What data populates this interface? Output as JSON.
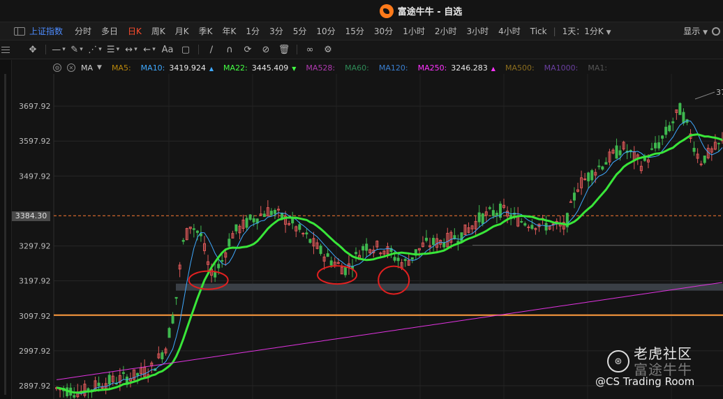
{
  "window": {
    "title": "富途牛牛 - 自选"
  },
  "toolbar": {
    "index_name": "上证指数",
    "periods": [
      {
        "label": "分时",
        "active": false
      },
      {
        "label": "多日",
        "active": false
      },
      {
        "label": "日K",
        "active": true
      },
      {
        "label": "周K",
        "active": false
      },
      {
        "label": "月K",
        "active": false
      },
      {
        "label": "季K",
        "active": false
      },
      {
        "label": "年K",
        "active": false
      },
      {
        "label": "1分",
        "active": false
      },
      {
        "label": "3分",
        "active": false
      },
      {
        "label": "5分",
        "active": false
      },
      {
        "label": "10分",
        "active": false
      },
      {
        "label": "15分",
        "active": false
      },
      {
        "label": "30分",
        "active": false
      },
      {
        "label": "1小时",
        "active": false
      },
      {
        "label": "2小时",
        "active": false
      },
      {
        "label": "3小时",
        "active": false
      },
      {
        "label": "4小时",
        "active": false
      },
      {
        "label": "Tick",
        "active": false
      }
    ],
    "range_select": "1天：1分K",
    "display_label": "显示",
    "accent_color": "#4d8cff",
    "active_color": "#ff4d2e"
  },
  "drawing_tools": {
    "text_tool_label": "Aa",
    "icons": [
      "crosshair-icon",
      "line-tool-icon",
      "pen-tool-icon",
      "multi-line-icon",
      "fib-tool-icon",
      "measure-icon",
      "arrow-tool-icon",
      "text-tool-icon",
      "note-icon",
      "brush-icon",
      "magnet-icon",
      "sync-icon",
      "hide-icon",
      "trash-icon",
      "link-icon",
      "settings-icon"
    ]
  },
  "legend": {
    "indicator": "MA",
    "items": [
      {
        "label": "MA5:",
        "value": "",
        "color": "#b8860b",
        "trend": ""
      },
      {
        "label": "MA10:",
        "value": "3419.924",
        "color": "#3fa9ff",
        "trend": "▲"
      },
      {
        "label": "MA22:",
        "value": "3445.409",
        "color": "#44ff44",
        "trend": "▼"
      },
      {
        "label": "MA528:",
        "value": "",
        "color": "#b03ab0",
        "trend": ""
      },
      {
        "label": "MA60:",
        "value": "",
        "color": "#2e8b57",
        "trend": ""
      },
      {
        "label": "MA120:",
        "value": "",
        "color": "#3a7fd0",
        "trend": ""
      },
      {
        "label": "MA250:",
        "value": "3246.283",
        "color": "#ff33ff",
        "trend": "▲"
      },
      {
        "label": "MA500:",
        "value": "",
        "color": "#8b6d1e",
        "trend": ""
      },
      {
        "label": "MA1000:",
        "value": "",
        "color": "#6a3fa0",
        "trend": ""
      },
      {
        "label": "MA1:",
        "value": "",
        "color": "#555555",
        "trend": ""
      }
    ]
  },
  "chart_data": {
    "type": "candlestick",
    "y_ticks": [
      "3697.92",
      "3597.92",
      "3497.92",
      "3297.92",
      "3197.92",
      "3097.92",
      "2997.92",
      "2897.92"
    ],
    "y_tick_values": [
      3697.92,
      3597.92,
      3497.92,
      3297.92,
      3197.92,
      3097.92,
      2997.92,
      2897.92
    ],
    "ylim": [
      2860,
      3790
    ],
    "last_price": "3384.30",
    "last_price_value": 3384.3,
    "peak_label_partial": "37",
    "horizontal_levels": [
      {
        "value": 3100,
        "color": "#ff9a3c",
        "kind": "support-line"
      },
      {
        "value": 3300,
        "color": "#555555",
        "kind": "resistance-line"
      }
    ],
    "support_zone": {
      "from": 3170,
      "to": 3190,
      "color": "#3a3f46"
    },
    "annotations": [
      {
        "shape": "ellipse",
        "color": "#e02020",
        "near": "first-dip"
      },
      {
        "shape": "ellipse",
        "color": "#e02020",
        "near": "second-dip"
      },
      {
        "shape": "ellipse",
        "color": "#e02020",
        "near": "third-dip"
      }
    ],
    "ma22_color": "#39e639",
    "ma10_color": "#3fa9ff",
    "ma250_color": "#e033e0",
    "up_color": "#e05a5a",
    "down_color": "#3fb84f"
  },
  "watermark": {
    "line1": "老虎社区",
    "line2": "富途牛牛",
    "credit": "@CS Trading Room"
  }
}
